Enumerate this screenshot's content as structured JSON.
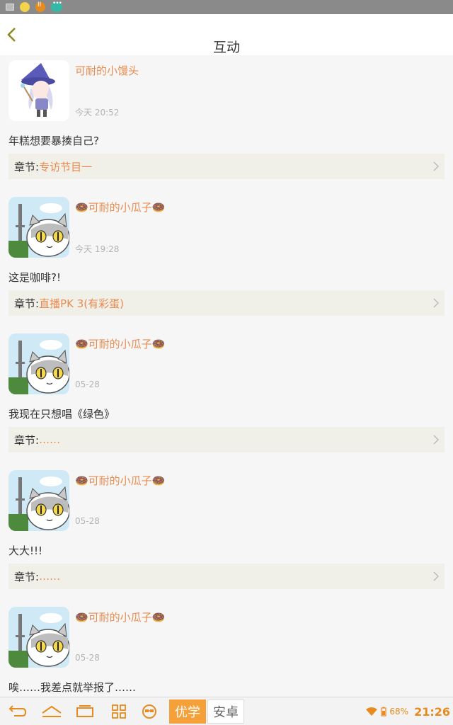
{
  "status_bar": {
    "icons": [
      "gallery-icon",
      "emoji-icon",
      "pause-icon",
      "more-icon"
    ]
  },
  "header": {
    "title": "互动",
    "back_icon": "chevron-left-icon"
  },
  "posts": [
    {
      "username": "可耐的小馒头",
      "time": "今天 20:52",
      "comment": "年糕想要暴揍自己?",
      "chapter_label": "章节:",
      "chapter_name": "专访节目一",
      "avatar": "witch-girl-avatar"
    },
    {
      "username": "🍩可耐的小瓜子🍩",
      "time": "今天 19:28",
      "comment": "这是咖啡?!",
      "chapter_label": "章节:",
      "chapter_name": "直播PK 3(有彩蛋)",
      "avatar": "cat-avatar"
    },
    {
      "username": "🍩可耐的小瓜子🍩",
      "time": "05-28",
      "comment": "我现在只想唱《绿色》",
      "chapter_label": "章节:",
      "chapter_name": "……",
      "avatar": "cat-avatar"
    },
    {
      "username": "🍩可耐的小瓜子🍩",
      "time": "05-28",
      "comment": "大大!!!",
      "chapter_label": "章节:",
      "chapter_name": "……",
      "avatar": "cat-avatar"
    },
    {
      "username": "🍩可耐的小瓜子🍩",
      "time": "05-28",
      "comment": "唉……我差点就举报了……",
      "chapter_label": "",
      "chapter_name": "",
      "avatar": "cat-avatar"
    }
  ],
  "nav_bar": {
    "buttons": [
      "back-icon",
      "home-icon",
      "recents-icon",
      "apps-grid-icon",
      "screenshot-icon"
    ],
    "tab_active": "优学",
    "tab_inactive": "安卓",
    "battery": "68%",
    "clock": "21:26"
  },
  "colors": {
    "accent": "#ea8b50",
    "nav_accent": "#f6a03a",
    "chapter_bg": "#f0f0e8"
  }
}
